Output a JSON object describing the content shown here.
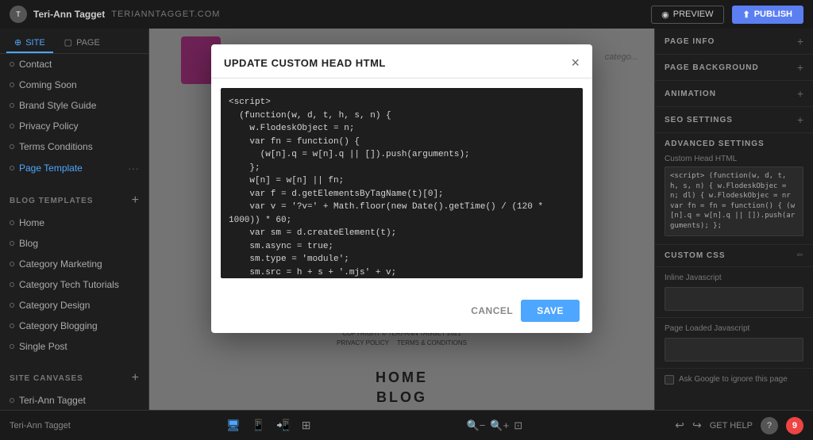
{
  "topbar": {
    "avatar_text": "T",
    "user_name": "Teri-Ann Tagget",
    "user_url": "TERIANNTAGGET.COM",
    "preview_label": "PREVIEW",
    "publish_label": "PUBLISH"
  },
  "left_sidebar": {
    "tabs": [
      {
        "id": "site",
        "label": "SITE",
        "active": true
      },
      {
        "id": "page",
        "label": "PAGE",
        "active": false
      }
    ],
    "site_items": [
      {
        "label": "Contact"
      },
      {
        "label": "Coming Soon"
      },
      {
        "label": "Brand Style Guide"
      },
      {
        "label": "Privacy Policy"
      },
      {
        "label": "Terms Conditions"
      },
      {
        "label": "Page Template",
        "active": true
      }
    ],
    "blog_templates_title": "BLOG TEMPLATES",
    "blog_templates": [
      {
        "label": "Home"
      },
      {
        "label": "Blog"
      },
      {
        "label": "Category Marketing"
      },
      {
        "label": "Category Tech Tutorials"
      },
      {
        "label": "Category Design"
      },
      {
        "label": "Category Blogging"
      },
      {
        "label": "Single Post"
      }
    ],
    "site_canvases_title": "SITE CANVASES",
    "site_canvases": [
      {
        "label": "Teri-Ann Tagget"
      }
    ]
  },
  "modal": {
    "title": "UPDATE CUSTOM HEAD HTML",
    "close_label": "×",
    "code_content": "<script>\n  (function(w, d, t, h, s, n) {\n    w.FlodeskObject = n;\n    var fn = function() {\n      (w[n].q = w[n].q || []).push(arguments);\n    };\n    w[n] = w[n] || fn;\n    var f = d.getElementsByTagName(t)[0];\n    var v = '?v=' + Math.floor(new Date().getTime() / (120 *\n1000)) * 60;\n    var sm = d.createElement(t);\n    sm.async = true;\n    sm.type = 'module';\n    sm.src = h + s + '.mjs' + v;\n    f.parentNode.insertBefore(sm, f);\n    var sn = d.createElement(t);\n    sn.async = true;\n    sn.noModule = true;\n    sn.src = h + s + '.iif' + v;",
    "cancel_label": "CANCEL",
    "save_label": "SAVE"
  },
  "right_sidebar": {
    "page_info_label": "PAGE INFO",
    "page_background_label": "PAGE BACKGROUND",
    "animation_label": "ANIMATION",
    "seo_settings_label": "SEO SETTINGS",
    "advanced_settings_label": "ADVANCED SETTINGS",
    "custom_head_html_label": "Custom Head HTML",
    "custom_head_preview": "<script> (function(w, d, t, h, s, n) { w.FlodeskObjec = n; dl) { w.FlodeskObjec = nr var fn = fn = function() { (w[n].q = w[n].q || []).push(arguments); };",
    "custom_css_label": "Custom CSS",
    "inline_javascript_label": "Inline Javascript",
    "page_loaded_javascript_label": "Page Loaded Javascript",
    "ask_google_label": "Ask Google to ignore this page"
  },
  "bottom_toolbar": {
    "page_name": "Teri-Ann Tagget",
    "get_help_label": "GET HELP",
    "notification_count": "9"
  },
  "page_preview": {
    "category_text": "catego...",
    "copyright_text": "COPYRIGHT © TERI-ANN TAGGET 2021",
    "privacy_text": "PRIVACY POLICY",
    "terms_text": "TERMS & CONDITIONS",
    "home_text": "HOME",
    "blog_text": "BLOG"
  }
}
